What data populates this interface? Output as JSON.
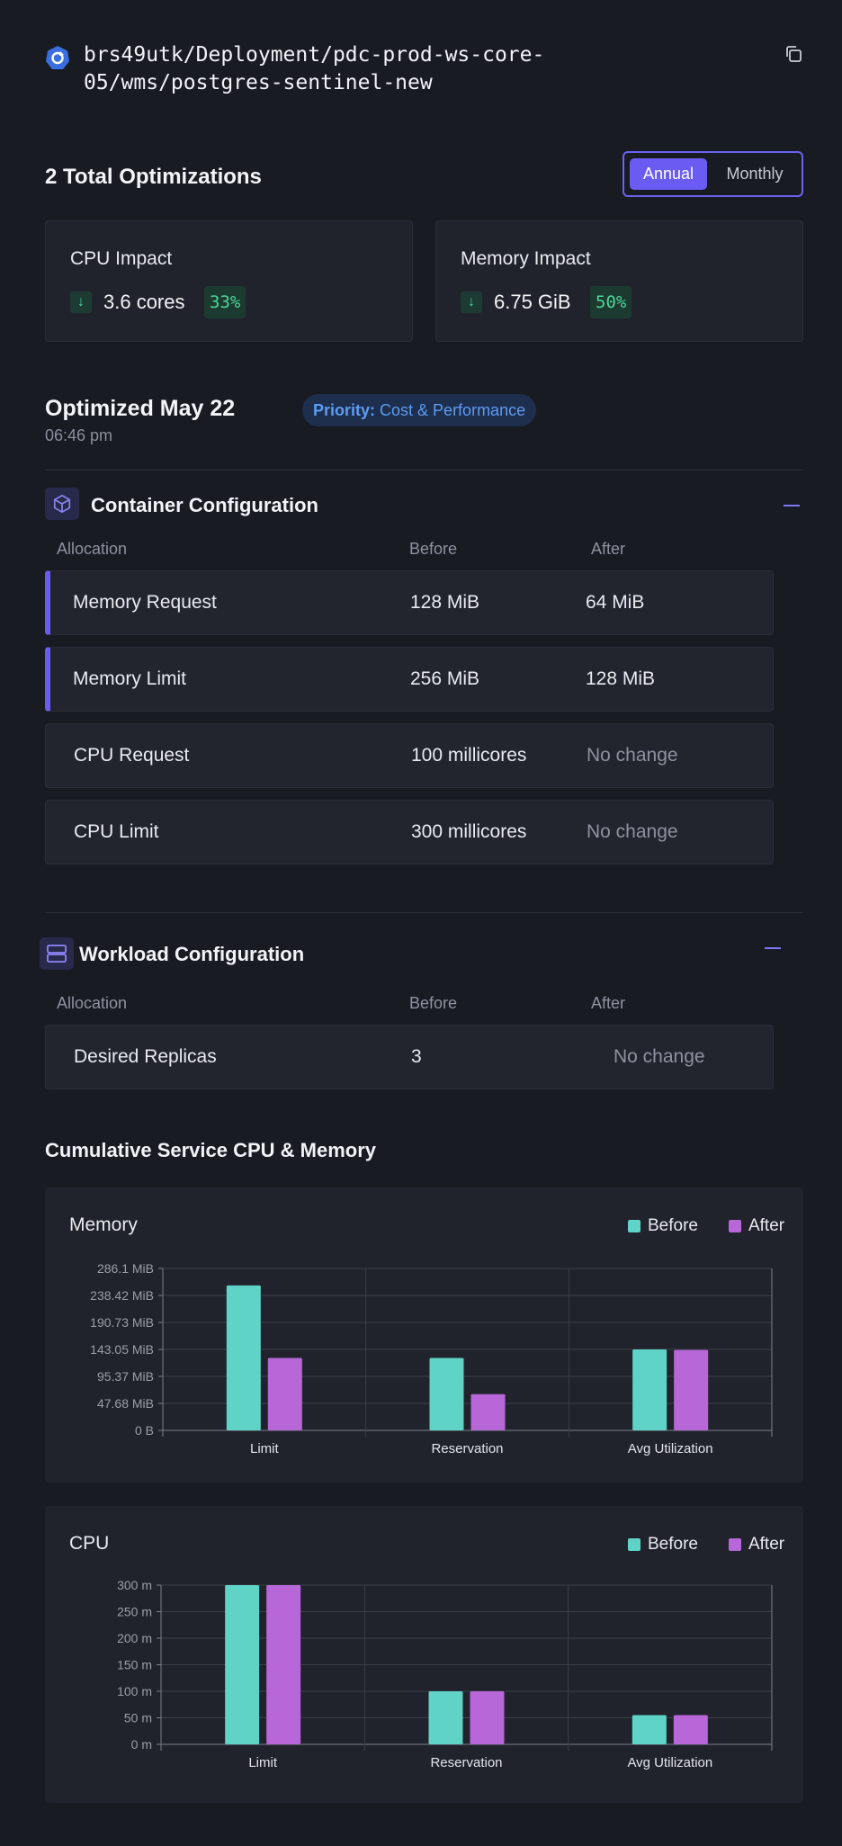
{
  "header": {
    "resource_path": "brs49utk/Deployment/pdc-prod-ws-core-05/wms/postgres-sentinel-new",
    "icon": "kubernetes-icon",
    "copy_icon": "copy-icon"
  },
  "summary": {
    "title": "2 Total Optimizations",
    "toggle": {
      "active": "Annual",
      "inactive": "Monthly"
    }
  },
  "impacts": {
    "cpu": {
      "title": "CPU Impact",
      "value": "3.6 cores",
      "percent": "33%"
    },
    "memory": {
      "title": "Memory Impact",
      "value": "6.75 GiB",
      "percent": "50%"
    }
  },
  "optimized": {
    "title": "Optimized May 22",
    "time": "06:46 pm",
    "priority_label": "Priority:",
    "priority_value": "Cost & Performance"
  },
  "container_config": {
    "title": "Container Configuration",
    "headers": {
      "allocation": "Allocation",
      "before": "Before",
      "after": "After"
    },
    "rows": [
      {
        "name": "Memory Request",
        "before": "128 MiB",
        "after": "64 MiB"
      },
      {
        "name": "Memory Limit",
        "before": "256 MiB",
        "after": "128 MiB"
      },
      {
        "name": "CPU Request",
        "before": "100 millicores",
        "after": "No change"
      },
      {
        "name": "CPU Limit",
        "before": "300 millicores",
        "after": "No change"
      }
    ]
  },
  "workload_config": {
    "title": "Workload Configuration",
    "headers": {
      "allocation": "Allocation",
      "before": "Before",
      "after": "After"
    },
    "rows": [
      {
        "name": "Desired Replicas",
        "before": "3",
        "after": "No change"
      }
    ]
  },
  "charts_section": {
    "title": "Cumulative Service CPU & Memory"
  },
  "colors": {
    "before": "#5ed3c6",
    "after": "#b867d9",
    "accent": "#6a5cf2"
  },
  "chart_data": [
    {
      "type": "bar",
      "title": "Memory",
      "categories": [
        "Limit",
        "Reservation",
        "Avg Utilization"
      ],
      "series": [
        {
          "name": "Before",
          "values": [
            256,
            128,
            143
          ]
        },
        {
          "name": "After",
          "values": [
            128,
            64,
            142
          ]
        }
      ],
      "unit": "MiB",
      "ylim": [
        0,
        286.1
      ],
      "yticks": [
        0,
        47.68,
        95.37,
        143.05,
        190.73,
        238.42,
        286.1
      ],
      "ytick_labels": [
        "0 B",
        "47.68 MiB",
        "95.37 MiB",
        "143.05 MiB",
        "190.73 MiB",
        "238.42 MiB",
        "286.1 MiB"
      ],
      "grid": true,
      "legend": "top-right"
    },
    {
      "type": "bar",
      "title": "CPU",
      "categories": [
        "Limit",
        "Reservation",
        "Avg Utilization"
      ],
      "series": [
        {
          "name": "Before",
          "values": [
            300,
            100,
            55
          ]
        },
        {
          "name": "After",
          "values": [
            300,
            100,
            55
          ]
        }
      ],
      "unit": "m",
      "ylim": [
        0,
        300
      ],
      "yticks": [
        0,
        50,
        100,
        150,
        200,
        250,
        300
      ],
      "ytick_labels": [
        "0 m",
        "50 m",
        "100 m",
        "150 m",
        "200 m",
        "250 m",
        "300 m"
      ],
      "grid": true,
      "legend": "top-right"
    }
  ]
}
